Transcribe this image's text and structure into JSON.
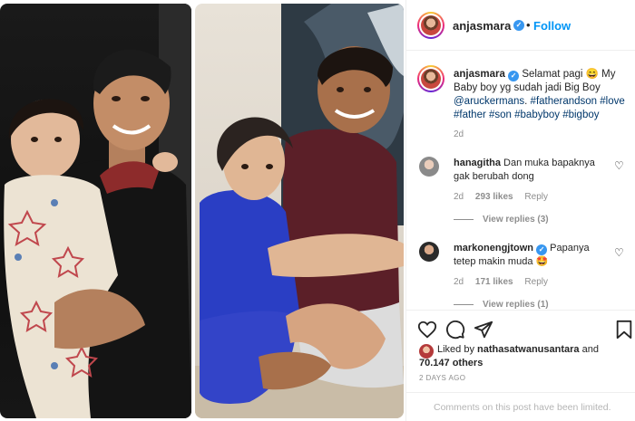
{
  "post": {
    "username": "anjasmara",
    "follow_label": "Follow",
    "follow_separator": "•"
  },
  "caption": {
    "username": "anjasmara",
    "text": "Selamat pagi 😄 My Baby boy yg sudah jadi Big Boy",
    "mention": "@aruckermans",
    "separator": ". ",
    "hashtags": "#fatherandson #love #father #son #babyboy #bigboy",
    "time": "2d"
  },
  "comments": [
    {
      "username": "hanagitha",
      "text": "Dan muka bapaknya gak berubah dong",
      "time": "2d",
      "likes": "293 likes",
      "reply": "Reply",
      "view_replies": "View replies (3)"
    },
    {
      "username": "markonengjtown",
      "text": "Papanya tetep makin muda 🤩",
      "time": "2d",
      "likes": "171 likes",
      "reply": "Reply",
      "view_replies": "View replies (1)"
    }
  ],
  "likes": {
    "liked_by_prefix": "Liked by",
    "liked_by_user": "nathasatwanusantara",
    "and": "and",
    "count": "70.147 others"
  },
  "post_time": "2 DAYS AGO",
  "comments_limited": "Comments on this post have been limited.",
  "icons": {
    "like": "heart-icon",
    "comment": "comment-icon",
    "share": "share-icon",
    "save": "bookmark-icon",
    "verified": "verified-badge-icon"
  },
  "colors": {
    "follow": "#0095f6",
    "verified": "#3897f0",
    "text": "#262626",
    "muted": "#8e8e8e",
    "hashtag": "#00376b"
  }
}
